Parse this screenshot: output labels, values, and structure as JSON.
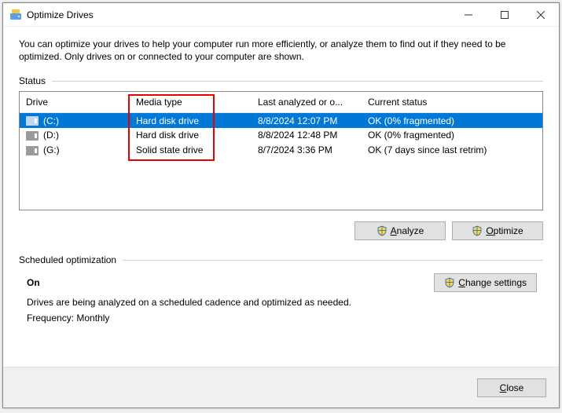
{
  "window": {
    "title": "Optimize Drives"
  },
  "intro": "You can optimize your drives to help your computer run more efficiently, or analyze them to find out if they need to be optimized. Only drives on or connected to your computer are shown.",
  "status_label": "Status",
  "columns": {
    "drive": "Drive",
    "media": "Media type",
    "last": "Last analyzed or o...",
    "status": "Current status"
  },
  "drives": [
    {
      "name": "(C:)",
      "media": "Hard disk drive",
      "last": "8/8/2024 12:07 PM",
      "status": "OK (0% fragmented)"
    },
    {
      "name": "(D:)",
      "media": "Hard disk drive",
      "last": "8/8/2024 12:48 PM",
      "status": "OK (0% fragmented)"
    },
    {
      "name": "(G:)",
      "media": "Solid state drive",
      "last": "8/7/2024 3:36 PM",
      "status": "OK (7 days since last retrim)"
    }
  ],
  "buttons": {
    "analyze_prefix": "A",
    "analyze_rest": "nalyze",
    "optimize_prefix": "O",
    "optimize_rest": "ptimize",
    "change_prefix": "C",
    "change_rest": "hange settings",
    "close_prefix": "C",
    "close_rest": "lose"
  },
  "scheduled": {
    "header": "Scheduled optimization",
    "on": "On",
    "desc": "Drives are being analyzed on a scheduled cadence and optimized as needed.",
    "freq": "Frequency: Monthly"
  }
}
